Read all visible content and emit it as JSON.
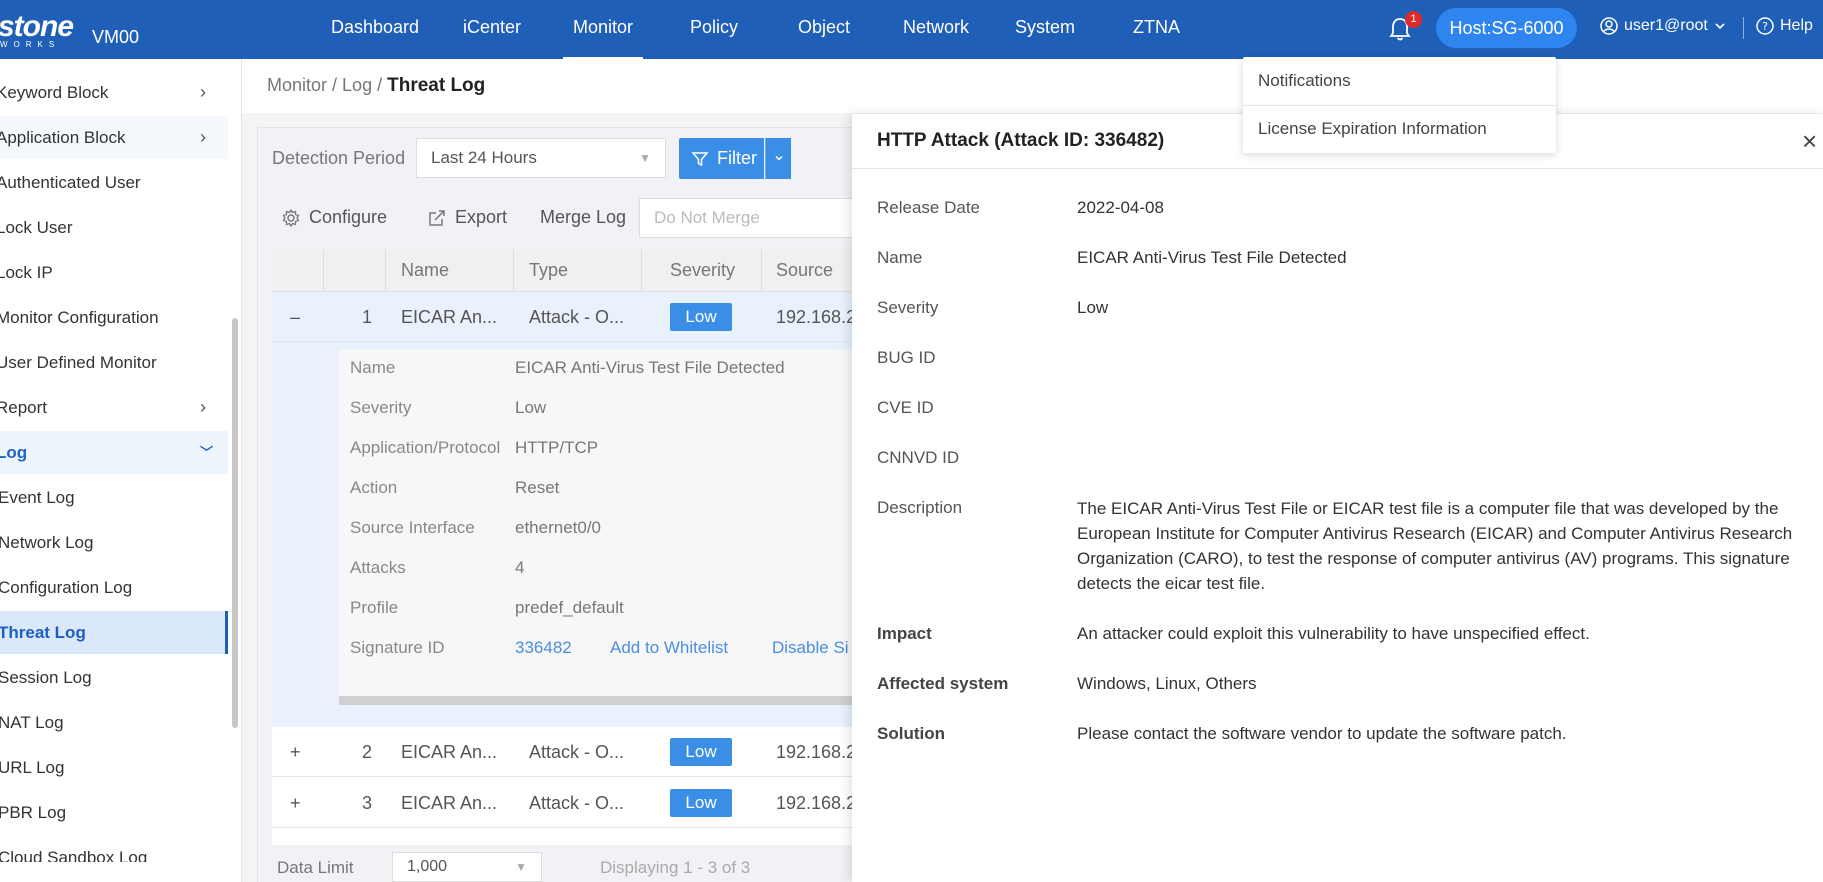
{
  "brand": {
    "logo": "stone",
    "logo_sub": "WORKS",
    "device": "VM00"
  },
  "nav": [
    {
      "label": "Dashboard"
    },
    {
      "label": "iCenter"
    },
    {
      "label": "Monitor"
    },
    {
      "label": "Policy"
    },
    {
      "label": "Object"
    },
    {
      "label": "Network"
    },
    {
      "label": "System"
    },
    {
      "label": "ZTNA"
    }
  ],
  "header": {
    "notification_count": "1",
    "host": "Host:SG-6000",
    "user": "user1@root",
    "help": "Help"
  },
  "notifications": {
    "items": [
      "Notifications",
      "License Expiration Information"
    ]
  },
  "sidebar": {
    "items": [
      {
        "label": "Keyword Block"
      },
      {
        "label": "Application Block"
      },
      {
        "label": "Authenticated User"
      },
      {
        "label": "Lock User"
      },
      {
        "label": "Lock IP"
      },
      {
        "label": "Monitor Configuration"
      },
      {
        "label": "User Defined Monitor"
      },
      {
        "label": "Report"
      },
      {
        "label": "Log"
      },
      {
        "label": "Event Log"
      },
      {
        "label": "Network Log"
      },
      {
        "label": "Configuration Log"
      },
      {
        "label": "Threat Log"
      },
      {
        "label": "Session Log"
      },
      {
        "label": "NAT Log"
      },
      {
        "label": "URL Log"
      },
      {
        "label": "PBR Log"
      },
      {
        "label": "Cloud Sandbox Log"
      }
    ]
  },
  "breadcrumb": {
    "part1": "Monitor",
    "sep": " / ",
    "part2": "Log",
    "current": "Threat Log"
  },
  "controls": {
    "detection_period_label": "Detection Period",
    "detection_period_value": "Last 24 Hours",
    "filter": "Filter",
    "configure": "Configure",
    "export": "Export",
    "merge_log_label": "Merge Log",
    "merge_placeholder": "Do Not Merge"
  },
  "table": {
    "headers": [
      "Name",
      "Type",
      "Severity",
      "Source"
    ],
    "rows": [
      {
        "toggle": "–",
        "num": "1",
        "name": "EICAR An...",
        "type": "Attack - O...",
        "severity": "Low",
        "source": "192.168.2"
      },
      {
        "toggle": "+",
        "num": "2",
        "name": "EICAR An...",
        "type": "Attack - O...",
        "severity": "Low",
        "source": "192.168.2"
      },
      {
        "toggle": "+",
        "num": "3",
        "name": "EICAR An...",
        "type": "Attack - O...",
        "severity": "Low",
        "source": "192.168.2"
      }
    ],
    "expanded": {
      "fields": [
        {
          "k": "Name",
          "v": "EICAR Anti-Virus Test File Detected"
        },
        {
          "k": "Severity",
          "v": "Low"
        },
        {
          "k": "Application/Protocol",
          "v": "HTTP/TCP"
        },
        {
          "k": "Action",
          "v": "Reset"
        },
        {
          "k": "Source Interface",
          "v": "ethernet0/0"
        },
        {
          "k": "Attacks",
          "v": "4"
        },
        {
          "k": "Profile",
          "v": "predef_default"
        }
      ],
      "signature_label": "Signature ID",
      "signature_id": "336482",
      "add_whitelist": "Add to Whitelist",
      "disable": "Disable Si"
    }
  },
  "footer": {
    "data_limit_label": "Data Limit",
    "data_limit_value": "1,000",
    "displaying": "Displaying 1 - 3 of 3"
  },
  "drawer": {
    "title": "HTTP Attack (Attack ID: 336482)",
    "fields": [
      {
        "k": "Release Date",
        "v": "2022-04-08"
      },
      {
        "k": "Name",
        "v": "EICAR Anti-Virus Test File Detected"
      },
      {
        "k": "Severity",
        "v": "Low"
      },
      {
        "k": "BUG ID",
        "v": ""
      },
      {
        "k": "CVE ID",
        "v": ""
      },
      {
        "k": "CNNVD ID",
        "v": ""
      },
      {
        "k": "Description",
        "v": "The EICAR Anti-Virus Test File or EICAR test file is a computer file that was developed by the European Institute for Computer Antivirus Research (EICAR) and Computer Antivirus Research Organization (CARO), to test the response of computer antivirus (AV) programs. This signature detects the eicar test file."
      },
      {
        "k": "Impact",
        "v": "An attacker could exploit this vulnerability to have unspecified effect."
      },
      {
        "k": "Affected system",
        "v": "Windows, Linux, Others"
      },
      {
        "k": "Solution",
        "v": "Please contact the software vendor to update the software patch."
      }
    ]
  },
  "colors": {
    "nav_bg": "#1f5fb8",
    "accent": "#3a8ee6",
    "badge": "#e02929",
    "host_pill": "#2e85ef"
  },
  "icons": [
    "bell-icon",
    "user-circle-icon",
    "help-circle-icon",
    "filter-icon",
    "gear-icon",
    "export-icon",
    "close-icon",
    "chevron-right-icon",
    "chevron-down-icon"
  ]
}
